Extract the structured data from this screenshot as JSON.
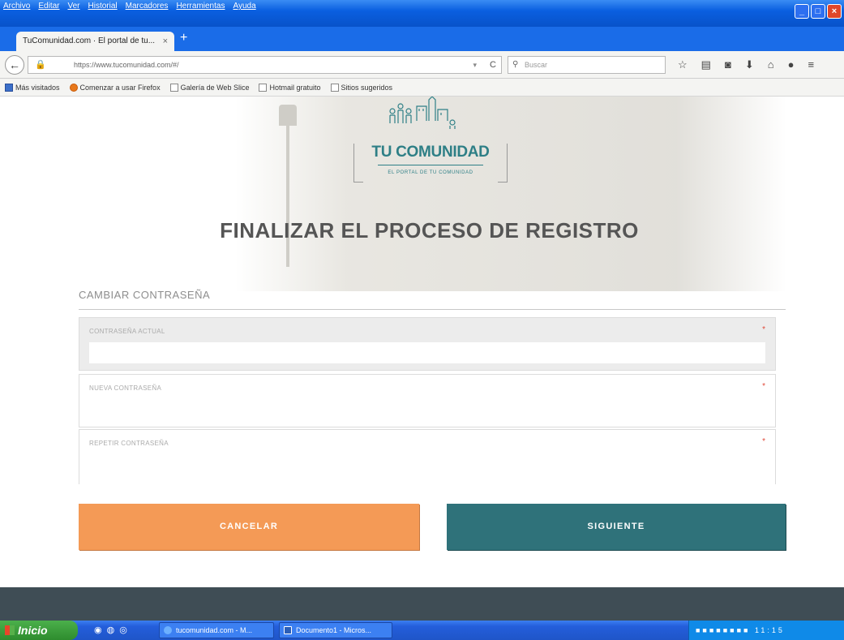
{
  "window": {
    "menu": [
      "Archivo",
      "Editar",
      "Ver",
      "Historial",
      "Marcadores",
      "Herramientas",
      "Ayuda"
    ],
    "controls": {
      "minimize": "_",
      "maximize": "□",
      "close": "×"
    }
  },
  "tabs": [
    {
      "label": "TuComunidad.com · El portal de tu...",
      "close": "×"
    }
  ],
  "newtab": "+",
  "nav": {
    "back": "←",
    "url": "https://www.tucomunidad.com/#/",
    "dropdown": "▾",
    "reload": "C",
    "search_placeholder": "Buscar",
    "icons": [
      "star-icon",
      "reading-list-icon",
      "pocket-icon",
      "download-icon",
      "home-icon",
      "chat-icon",
      "menu-icon"
    ]
  },
  "bookmarks": [
    {
      "label": "Más visitados",
      "icon": "blue"
    },
    {
      "label": "Comenzar a usar Firefox",
      "icon": "ff"
    },
    {
      "label": "Galería de Web Slice",
      "icon": ""
    },
    {
      "label": "Hotmail gratuito",
      "icon": ""
    },
    {
      "label": "Sitios sugeridos",
      "icon": ""
    }
  ],
  "page": {
    "brand": "TU COMUNIDAD",
    "tagline": "EL PORTAL DE TU COMUNIDAD",
    "title": "FINALIZAR EL PROCESO DE REGISTRO",
    "section": "CAMBIAR CONTRASEÑA",
    "fields": [
      {
        "label": "CONTRASEÑA ACTUAL",
        "required": "*",
        "value": ""
      },
      {
        "label": "NUEVA CONTRASEÑA",
        "required": "*",
        "value": ""
      },
      {
        "label": "REPETIR CONTRASEÑA",
        "required": "*",
        "value": ""
      }
    ],
    "buttons": {
      "cancel": "CANCELAR",
      "next": "SIGUIENTE"
    }
  },
  "taskbar": {
    "start": "Inicio",
    "tasks": [
      "tucomunidad.com - M...",
      "Documento1 - Micros..."
    ],
    "clock": "11:15"
  },
  "colors": {
    "brand": "#2e7f86",
    "cancel": "#f49a56",
    "next": "#2f727a",
    "footer": "#3f4d55",
    "required": "#e04a3a"
  }
}
